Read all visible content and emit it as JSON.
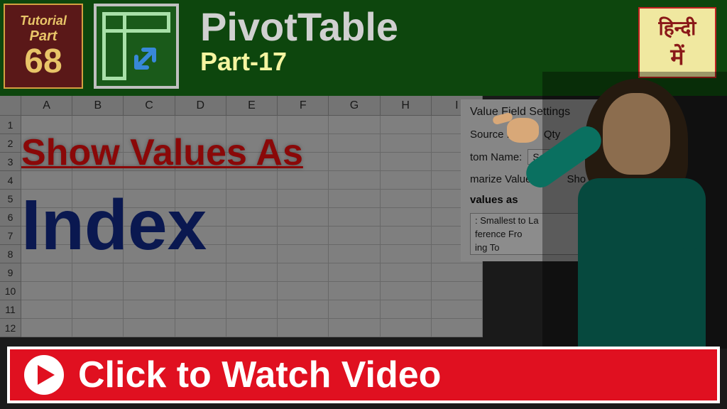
{
  "tutorial": {
    "label": "Tutorial",
    "part_label": "Part",
    "number": "68"
  },
  "header": {
    "title": "PivotTable",
    "subtitle": "Part-17"
  },
  "hindi": {
    "line1": "हिन्दी",
    "line2": "में"
  },
  "spreadsheet": {
    "columns": [
      "A",
      "B",
      "C",
      "D",
      "E",
      "F",
      "G",
      "H",
      "I"
    ],
    "rows": [
      "1",
      "2",
      "3",
      "4",
      "5",
      "6",
      "7",
      "8",
      "9",
      "10",
      "11",
      "12"
    ]
  },
  "overlay": {
    "show_values": "Show Values As",
    "index": "Index"
  },
  "dialog": {
    "title": "Value Field Settings",
    "source_label": "Source Name:",
    "source_value": "Qty",
    "custom_label": "tom Name:",
    "custom_value": "Sales",
    "tab1": "marize Values By",
    "tab2": "Sho",
    "section": "values as",
    "list_item1": ": Smallest to La",
    "list_item2": "ference Fro",
    "list_item3": "ing To"
  },
  "cta": {
    "text": "Click to Watch Video"
  }
}
